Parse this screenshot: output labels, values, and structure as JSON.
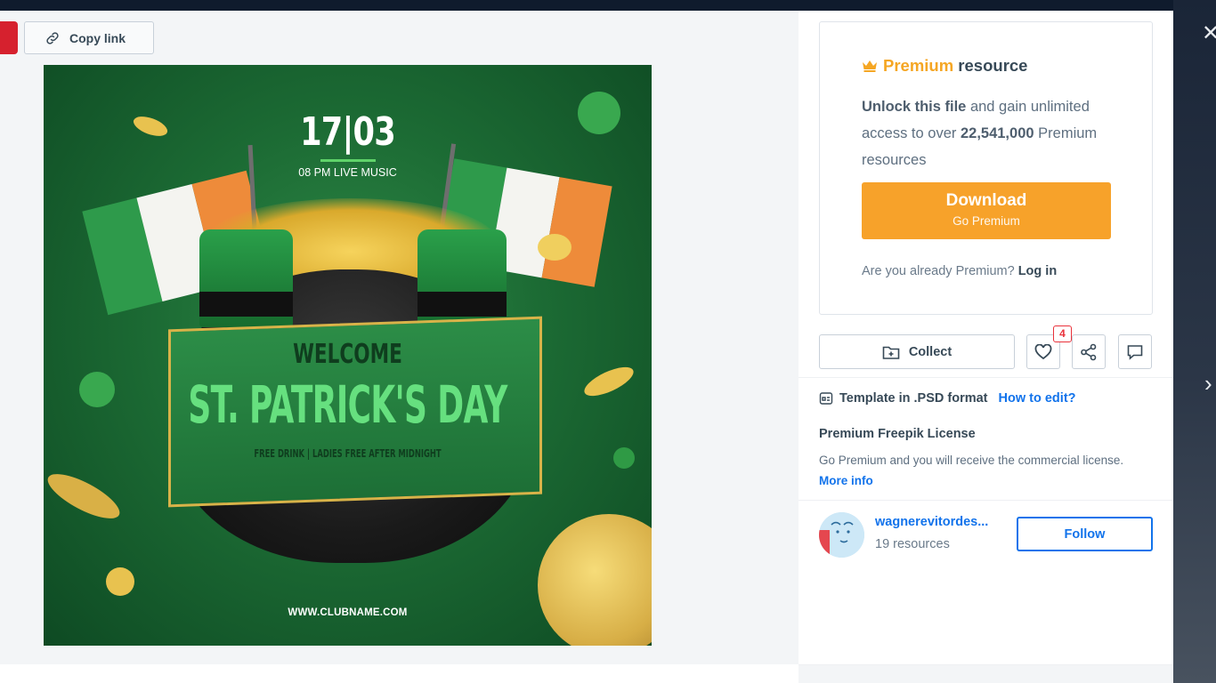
{
  "window": {
    "close_icon": "close-icon",
    "next_icon": "chevron-right-icon"
  },
  "toolbar": {
    "copy_link_label": "Copy link",
    "copy_icon": "link-icon"
  },
  "artwork": {
    "date": "17|03",
    "music": "08 PM LIVE MUSIC",
    "welcome": "WELCOME",
    "title": "ST. PATRICK'S DAY",
    "subtitle": "FREE DRINK | LADIES FREE AFTER MIDNIGHT",
    "url": "WWW.CLUBNAME.COM"
  },
  "premium": {
    "crown_icon": "crown-icon",
    "label_premium": "Premium",
    "label_resource": " resource",
    "unlock_bold": "Unlock this file",
    "unlock_rest": " and gain unlimited access to over ",
    "count": "22,541,000",
    "count_rest": " Premium resources",
    "download_label": "Download",
    "download_sub": "Go Premium",
    "already_text": "Are you already Premium? ",
    "login_label": "Log in",
    "accent_color": "#f7a22a"
  },
  "actions": {
    "collect_label": "Collect",
    "like_count": "4"
  },
  "info": {
    "format_text": "Template in .PSD format",
    "how_to_edit": "How to edit?",
    "license_title": "Premium Freepik License",
    "license_text": "Go Premium and you will receive the commercial license. ",
    "more_info": "More info"
  },
  "author": {
    "name": "wagnerevitordes...",
    "resources": "19 resources",
    "follow_label": "Follow"
  },
  "colors": {
    "link_blue": "#1273eb",
    "text_dark": "#374957",
    "badge_red": "#e9323b"
  }
}
